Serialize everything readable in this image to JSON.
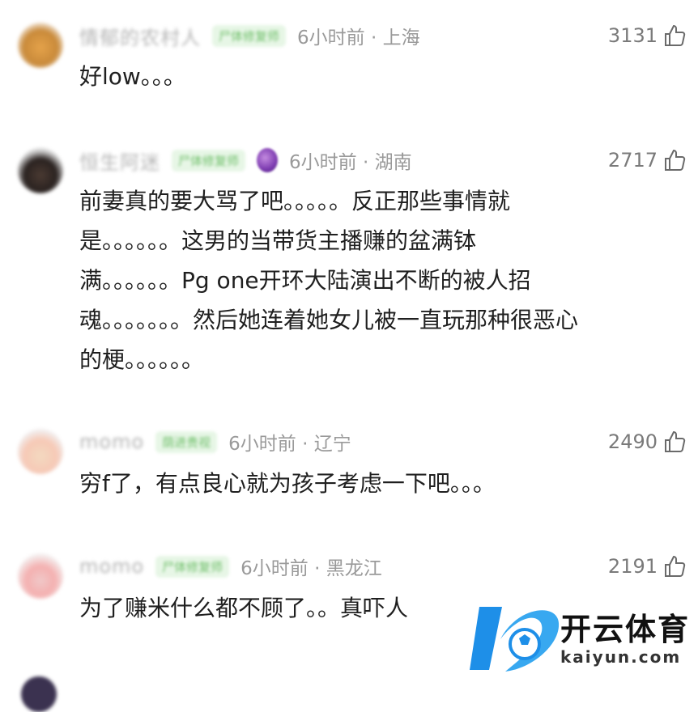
{
  "comments": [
    {
      "name": "情郁的农村人",
      "badge": "尸体修复师",
      "time": "6小时前 · 上海",
      "likes": "3131",
      "text": "好low。。。"
    },
    {
      "name": "恒生阿迷",
      "badge": "尸体修复师",
      "time": "6小时前 · 湖南",
      "likes": "2717",
      "text": "前妻真的要大骂了吧。。。。。反正那些事情就\n是。。。。。。这男的当带货主播赚的盆满钵\n满。。。。。。Pg one开环大陆演出不断的被人招\n魂。。。。。。。然后她连着她女儿被一直玩那种很恶心\n的梗。。。。。。"
    },
    {
      "name": "momo",
      "badge": "荫进贵视",
      "time": "6小时前 · 辽宁",
      "likes": "2490",
      "text": "穷f了，有点良心就为孩子考虑一下吧。。。"
    },
    {
      "name": "momo",
      "badge": "尸体修复师",
      "time": "6小时前 · 黑龙江",
      "likes": "2191",
      "text": "为了赚米什么都不顾了。。真吓人"
    }
  ],
  "icons": {
    "like": "thumbs-up-icon",
    "medal": "medal-icon"
  },
  "watermark": {
    "cn": "开云体育",
    "en": "kaiyun.com",
    "accent": "#1e8fe8"
  }
}
